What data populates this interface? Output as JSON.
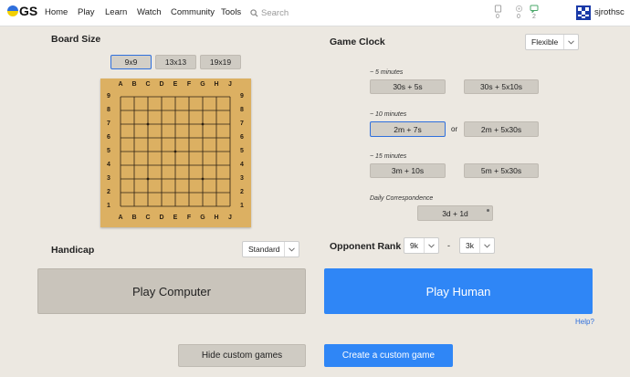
{
  "nav": {
    "logo_text": "GS",
    "items": [
      "Home",
      "Play",
      "Learn",
      "Watch",
      "Community",
      "Tools"
    ],
    "search_placeholder": "Search",
    "stats": [
      {
        "icon": "notification-icon",
        "value": "0"
      },
      {
        "icon": "spiral-icon",
        "value": "0"
      },
      {
        "icon": "chat-icon",
        "value": "2"
      }
    ],
    "username": "sjrothsc"
  },
  "board_size": {
    "title": "Board Size",
    "options": [
      "9x9",
      "13x13",
      "19x19"
    ],
    "selected": "9x9",
    "columns": [
      "A",
      "B",
      "C",
      "D",
      "E",
      "F",
      "G",
      "H",
      "J"
    ],
    "rows": [
      "9",
      "8",
      "7",
      "6",
      "5",
      "4",
      "3",
      "2",
      "1"
    ]
  },
  "game_clock": {
    "title": "Game Clock",
    "mode": "Flexible",
    "groups": [
      {
        "label": "~ 5 minutes",
        "options": [
          "30s + 5s",
          "30s + 5x10s"
        ]
      },
      {
        "label": "~ 10 minutes",
        "options": [
          "2m + 7s",
          "2m + 5x30s"
        ],
        "separator": "or",
        "selected": "2m + 7s"
      },
      {
        "label": "~ 15 minutes",
        "options": [
          "3m + 10s",
          "5m + 5x30s"
        ]
      },
      {
        "label": "Daily Correspondence",
        "options": [
          "3d + 1d"
        ]
      }
    ]
  },
  "handicap": {
    "title": "Handicap",
    "value": "Standard"
  },
  "opponent_rank": {
    "title": "Opponent Rank",
    "min": "9k",
    "separator": "-",
    "max": "3k"
  },
  "actions": {
    "play_computer": "Play Computer",
    "play_human": "Play Human",
    "help": "Help?",
    "hide_custom": "Hide custom games",
    "create_custom": "Create a custom game"
  },
  "colors": {
    "accent": "#2f86f6",
    "board": "#dcb062",
    "button_grey": "#cfcbc3"
  }
}
